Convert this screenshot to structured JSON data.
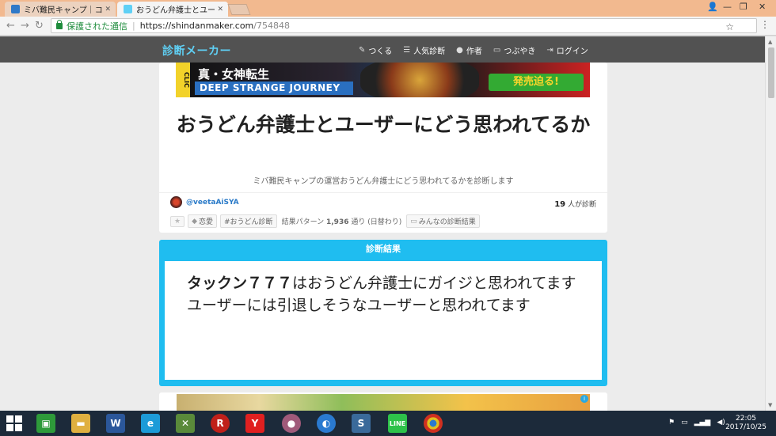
{
  "browser": {
    "tabs": [
      {
        "title": "ミバ難民キャンプ｜コミュニテ",
        "active": false
      },
      {
        "title": "おうどん弁護士とユーザーにど",
        "active": true
      }
    ],
    "secure_label": "保護された通信",
    "url_host": "https://shindanmaker.com",
    "url_path": "/754848"
  },
  "site": {
    "logo": "診断メーカー",
    "nav": [
      {
        "label": "つくる",
        "icon": "pencil-icon"
      },
      {
        "label": "人気診断",
        "icon": "list-icon"
      },
      {
        "label": "作者",
        "icon": "person-icon"
      },
      {
        "label": "つぶやき",
        "icon": "speech-icon"
      },
      {
        "label": "ログイン",
        "icon": "login-icon"
      }
    ]
  },
  "banner": {
    "clic": "CLIC",
    "line1": "真・女神転生",
    "line2": "DEEP STRANGE JOURNEY",
    "cta": "発売迫る!"
  },
  "diagnosis": {
    "title": "おうどん弁護士とユーザーにどう思われてるか",
    "description": "ミバ難民キャンプの運営おうどん弁護士にどう思われてるかを診断します",
    "author": "@veetaAiSYA",
    "count_number": "19",
    "count_suffix": "人が診断",
    "tags": {
      "star": "★",
      "tag1": "恋愛",
      "tag2": "#おうどん診断",
      "pattern_label": "結果パターン",
      "pattern_count": "1,936",
      "pattern_suffix": "通り (日替わり)",
      "everyone": "みんなの診断結果"
    }
  },
  "result": {
    "heading": "診断結果",
    "name": "タックン７７７",
    "line1_rest": "はおうどん弁護士にガイジと思われてます",
    "line2": "ユーザーには引退しそうなユーザーと思われてます"
  },
  "taskbar": {
    "time": "22:05",
    "date": "2017/10/25"
  },
  "colors": {
    "tabstrip": "#f2b98f",
    "site_header": "#525252",
    "logo": "#5fd0f5",
    "result_accent": "#1fbdf0",
    "taskbar": "#1c2a3a"
  }
}
